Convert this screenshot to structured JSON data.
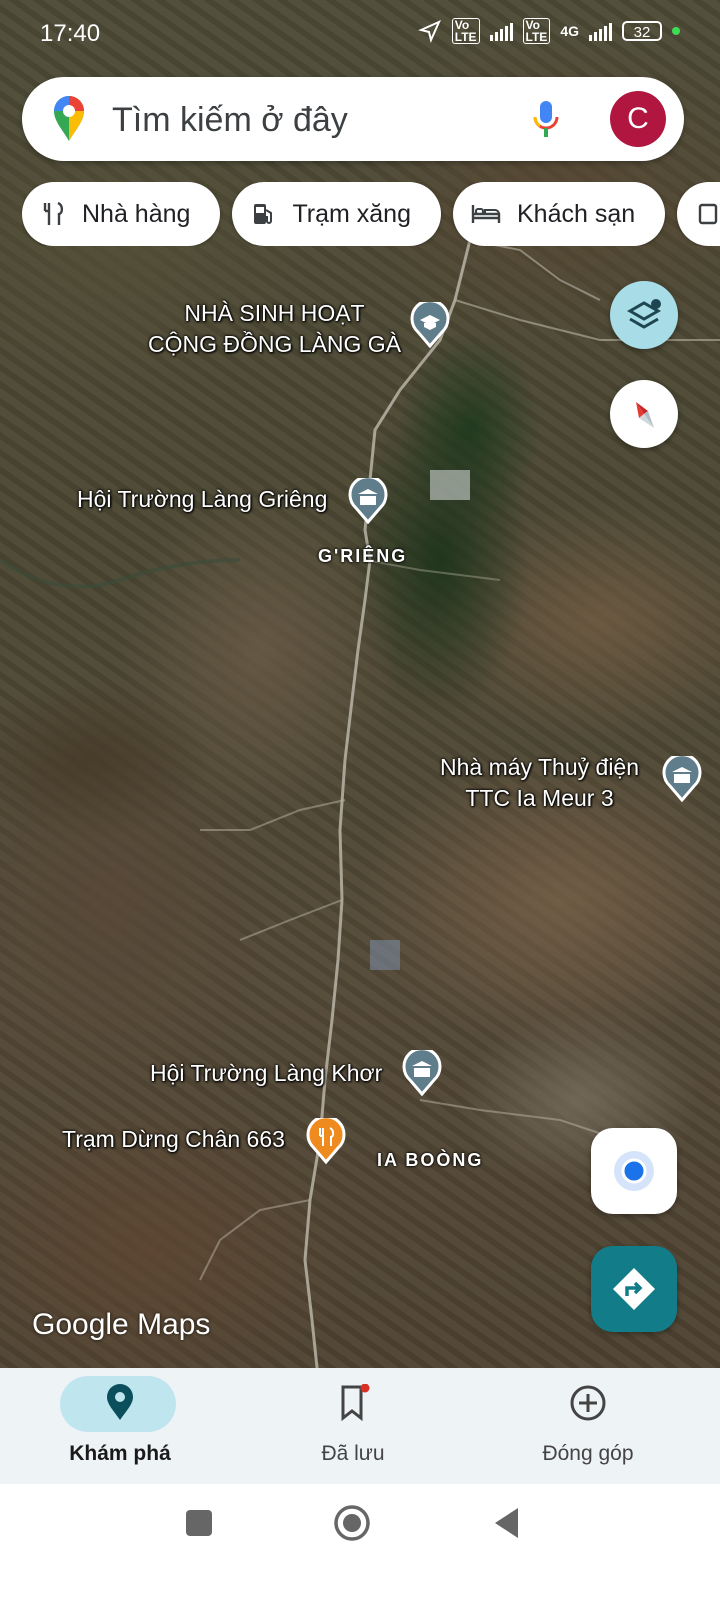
{
  "status_bar": {
    "time": "17:40",
    "network": "4G",
    "battery": "32"
  },
  "search": {
    "placeholder": "Tìm kiếm ở đây",
    "avatar_letter": "C"
  },
  "chips": [
    {
      "label": "Nhà hàng",
      "icon": "restaurant-icon"
    },
    {
      "label": "Trạm xăng",
      "icon": "gas-station-icon"
    },
    {
      "label": "Khách sạn",
      "icon": "hotel-icon"
    }
  ],
  "map": {
    "poi_labels": {
      "community_house": "NHÀ SINH HOẠT\nCỘNG ĐỒNG LÀNG GÀ",
      "hall_grieng": "Hội Trường Làng Griêng",
      "hydropower": "Nhà máy Thuỷ điện\nTTC Ia Meur 3",
      "hall_khor": "Hội Trường Làng Khơr",
      "rest_stop": "Trạm Dừng Chân 663"
    },
    "area_labels": {
      "grieng": "G'RIÊNG",
      "ia_boong": "IA BOÒNG"
    },
    "logo": "Google Maps"
  },
  "bottom_nav": [
    {
      "label": "Khám phá",
      "icon": "explore-pin-icon",
      "active": true
    },
    {
      "label": "Đã lưu",
      "icon": "bookmark-icon",
      "active": false
    },
    {
      "label": "Đóng góp",
      "icon": "add-circle-icon",
      "active": false
    }
  ],
  "colors": {
    "accent": "#137c89",
    "avatar": "#b0163f",
    "nav_bg": "#eef3f6",
    "active_pill": "#bfe6ee"
  }
}
